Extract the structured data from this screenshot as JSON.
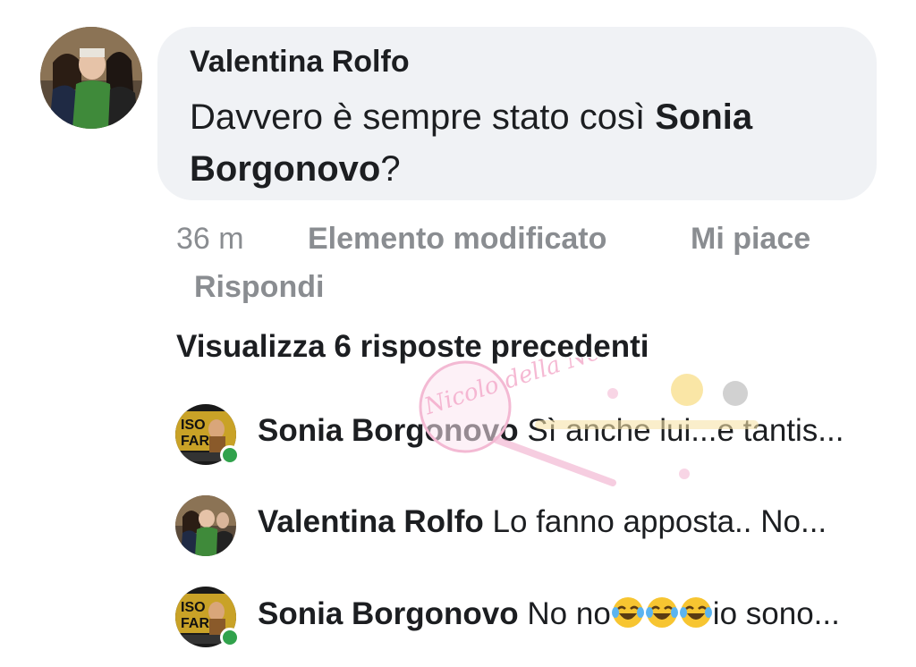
{
  "main_comment": {
    "author": "Valentina Rolfo",
    "text_prefix": "Davvero è sempre stato così ",
    "mention": "Sonia Borgonovo",
    "text_suffix": "?"
  },
  "meta": {
    "time": "36 m",
    "edited": "Elemento modificato",
    "like": "Mi piace",
    "reply": "Rispondi"
  },
  "view_previous": "Visualizza 6 risposte precedenti",
  "replies": [
    {
      "author": "Sonia Borgonovo",
      "text": "Sì anche lui...e tantis...",
      "online": true
    },
    {
      "author": "Valentina Rolfo",
      "text": "Lo fanno apposta.. No...",
      "online": false
    },
    {
      "author": "Sonia Borgonovo",
      "text_before": "No no",
      "emoji": "laughing-tears-emoji",
      "emoji_count": 3,
      "text_after": "io sono...",
      "online": true
    }
  ],
  "watermark": {
    "text": "Nicolo della Neka"
  },
  "colors": {
    "bubble_bg": "#f0f2f5",
    "meta_text": "#8a8d91",
    "online_dot": "#31a24c"
  }
}
